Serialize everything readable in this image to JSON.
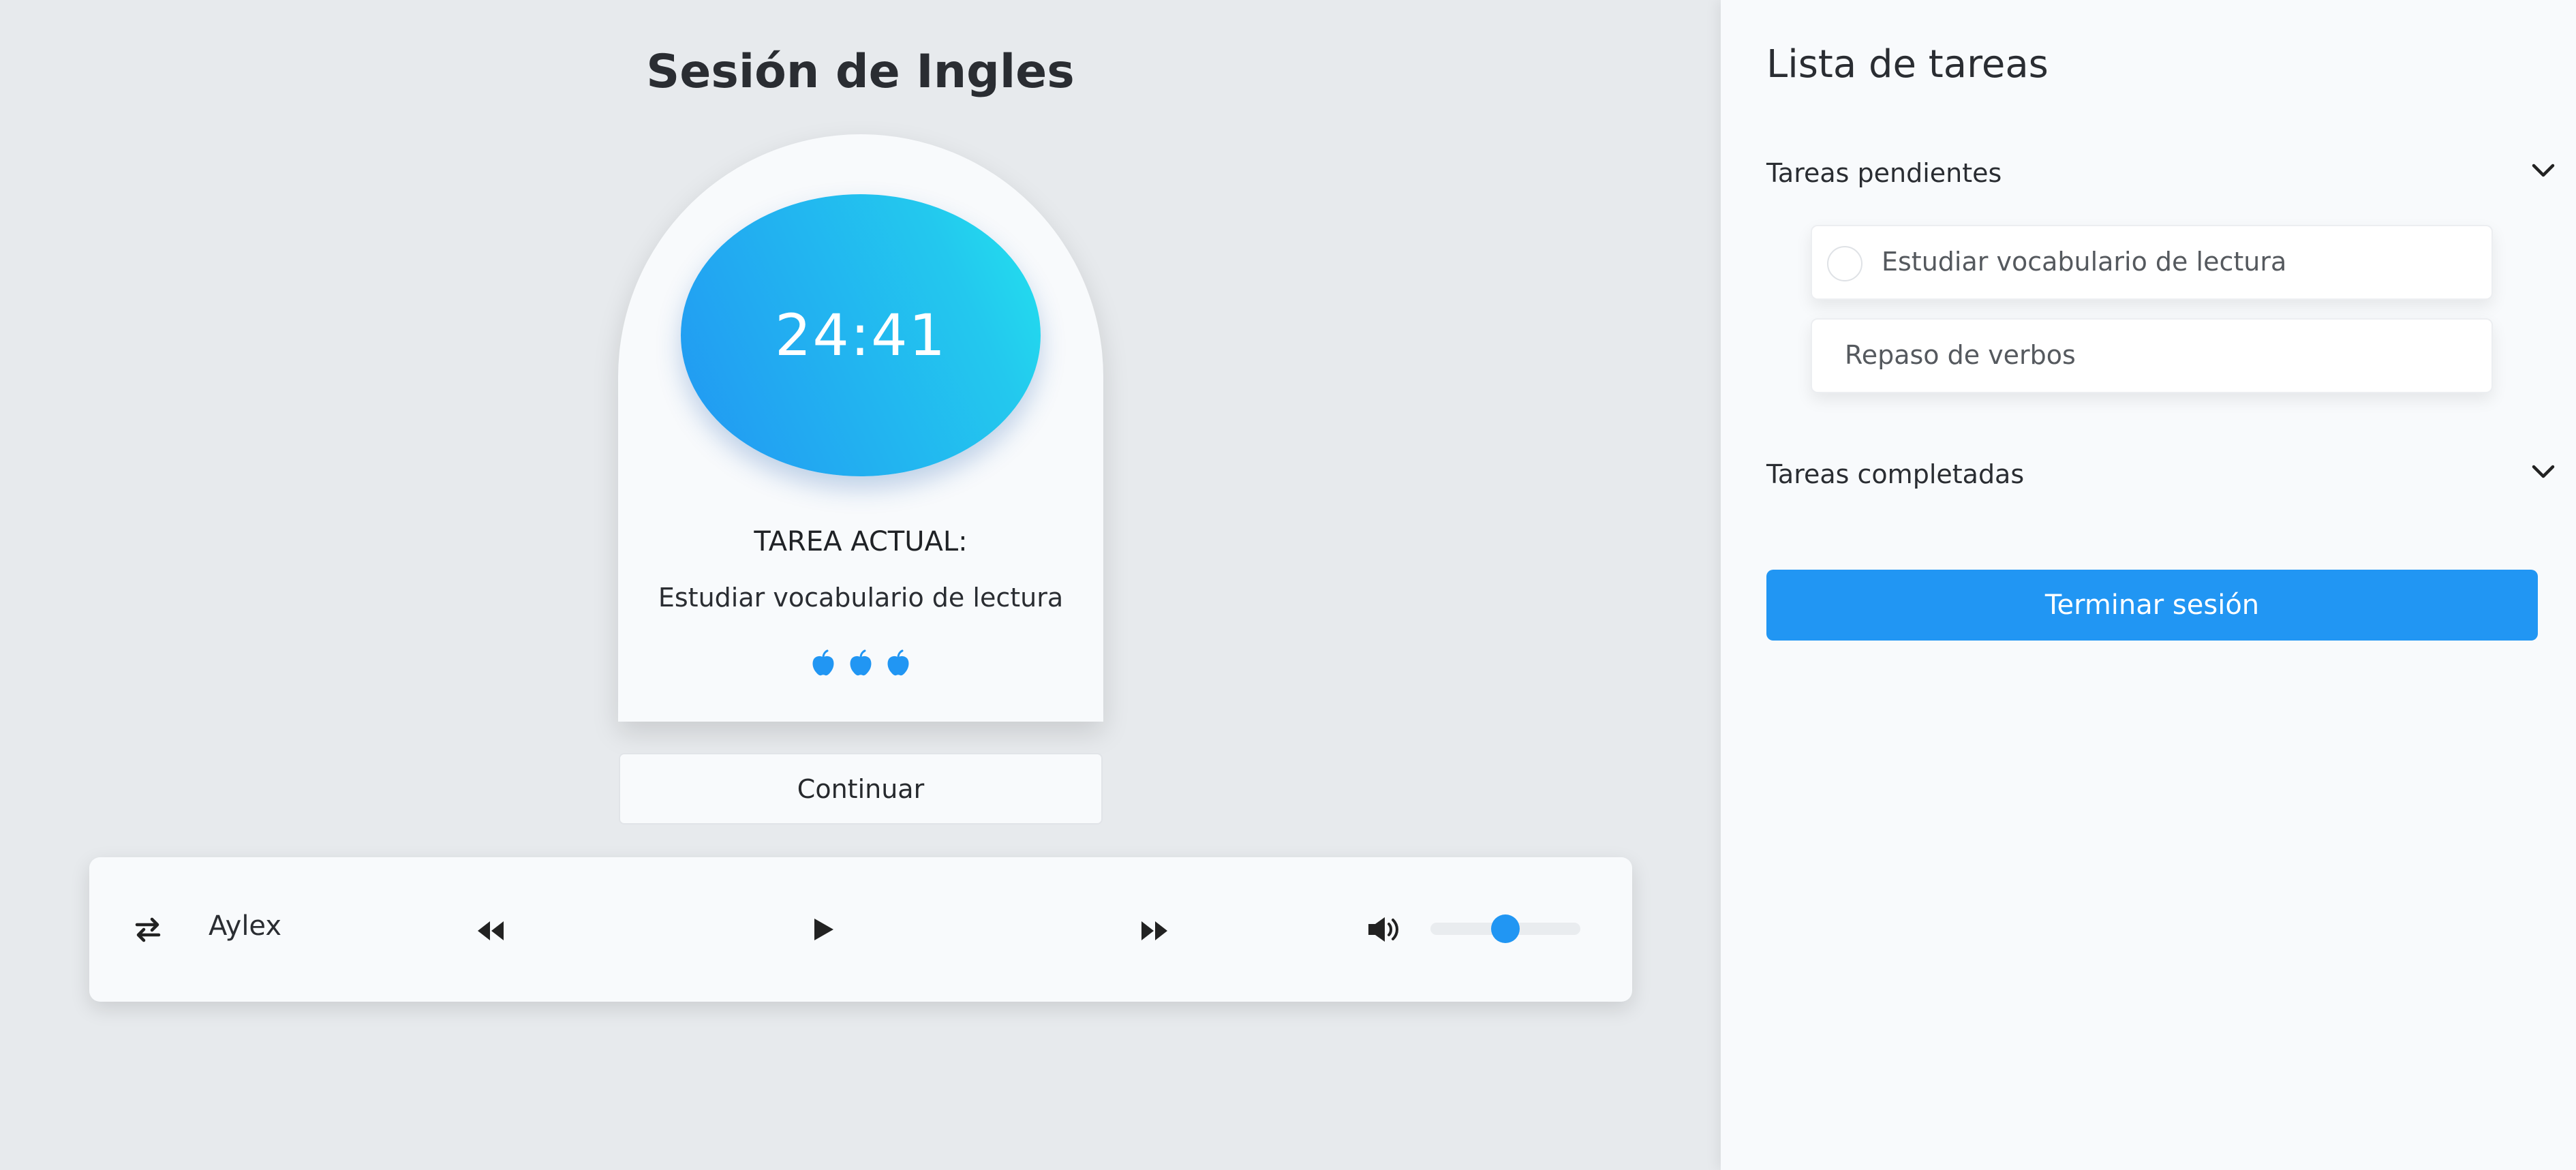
{
  "session": {
    "title": "Sesión de Ingles",
    "timer": "24:41",
    "current_task_label": "TAREA ACTUAL:",
    "current_task_name": "Estudiar vocabulario de lectura",
    "apple_icons": [
      "apple-icon",
      "apple-icon",
      "apple-icon"
    ],
    "continue_label": "Continuar"
  },
  "player": {
    "artist": "Aylex",
    "icons": {
      "shuffle": "swap-arrows-icon",
      "previous": "rewind-icon",
      "play": "play-icon",
      "next": "fast-forward-icon",
      "volume": "volume-icon"
    },
    "volume_level": 0.5
  },
  "tasks": {
    "title": "Lista de tareas",
    "pending_label": "Tareas pendientes",
    "pending_items": [
      "Estudiar vocabulario de lectura",
      "Repaso de verbos"
    ],
    "completed_label": "Tareas completadas",
    "finish_label": "Terminar sesión"
  },
  "colors": {
    "accent": "#2196f3",
    "timer_gradient_start": "#2196f3",
    "timer_gradient_end": "#23e4ee",
    "background": "#e7eaed",
    "panel": "#f8fafc"
  }
}
